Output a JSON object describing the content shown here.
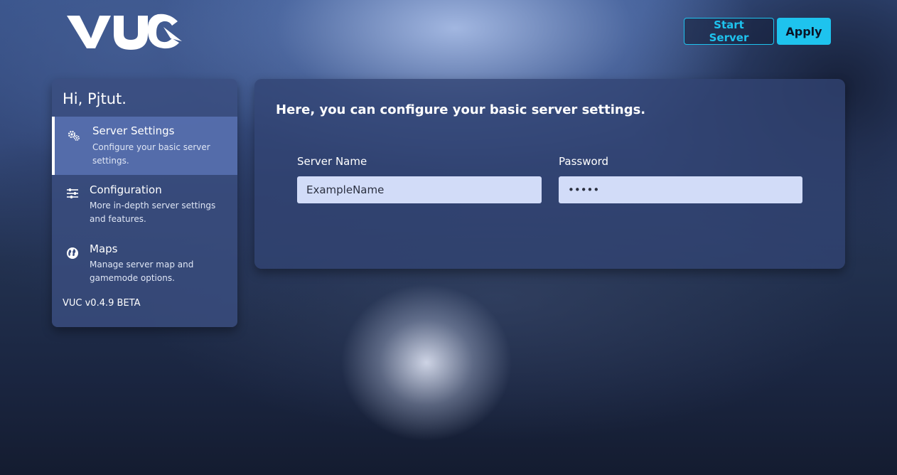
{
  "app": {
    "logo_text": "VUC",
    "version": "VUC v0.4.9 BETA"
  },
  "header": {
    "start_server_label": "Start Server",
    "apply_label": "Apply"
  },
  "sidebar": {
    "greeting": "Hi, Pjtut.",
    "items": [
      {
        "title": "Server Settings",
        "desc": "Configure your basic server settings.",
        "icon": "gears-icon",
        "active": true
      },
      {
        "title": "Configuration",
        "desc": "More in-depth server settings and features.",
        "icon": "sliders-icon",
        "active": false
      },
      {
        "title": "Maps",
        "desc": "Manage server map and gamemode options.",
        "icon": "globe-icon",
        "active": false
      }
    ]
  },
  "main": {
    "heading": "Here, you can configure your basic server settings.",
    "fields": {
      "server_name": {
        "label": "Server Name",
        "value": "ExampleName"
      },
      "password": {
        "label": "Password",
        "value": "•••••"
      }
    }
  },
  "colors": {
    "accent": "#1ec3ee",
    "input_bg": "#d2dcf8",
    "panel_bg": "#32447380"
  }
}
